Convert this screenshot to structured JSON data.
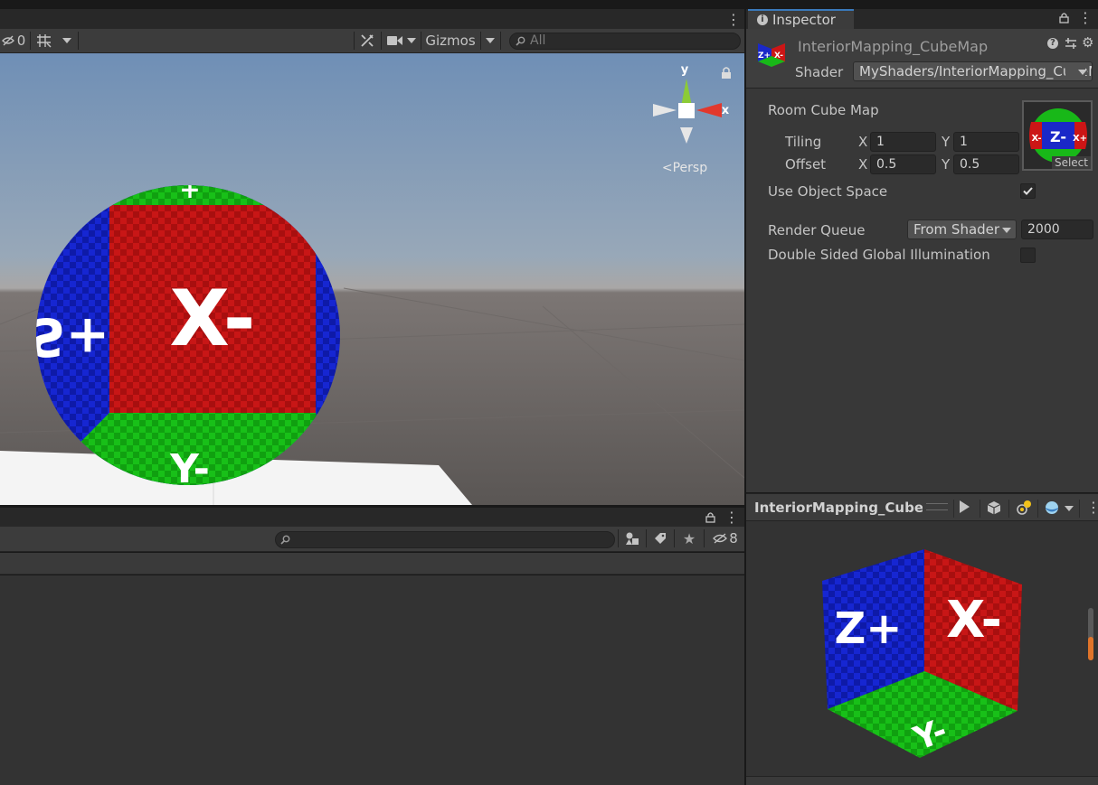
{
  "scene_toolbar": {
    "hidden_count": "0",
    "gizmos_label": "Gizmos",
    "search_placeholder": "All"
  },
  "viewport": {
    "axis_y": "y",
    "axis_x": "x",
    "projection_label": "<Persp",
    "sphere_labels": [
      "X-",
      "S+",
      "Y-",
      "+"
    ]
  },
  "project": {
    "hidden_count": "8"
  },
  "inspector": {
    "tab_label": "Inspector",
    "asset_name": "InteriorMapping_CubeMap",
    "shader_label": "Shader",
    "shader_value": "MyShaders/InteriorMapping_CubeMap",
    "room_cube_map_label": "Room Cube Map",
    "tiling_label": "Tiling",
    "offset_label": "Offset",
    "x_label": "X",
    "y_label": "Y",
    "tiling_x": "1",
    "tiling_y": "1",
    "offset_x": "0.5",
    "offset_y": "0.5",
    "select_label": "Select",
    "use_object_space_label": "Use Object Space",
    "use_object_space_checked": true,
    "render_queue_label": "Render Queue",
    "render_queue_mode": "From Shader",
    "render_queue_value": "2000",
    "double_sided_gi_label": "Double Sided Global Illumination",
    "double_sided_gi_checked": false
  },
  "preview": {
    "title": "InteriorMapping_CubeMa",
    "cube_labels": [
      "Z+",
      "X-",
      "Y-"
    ]
  },
  "colors": {
    "accent": "#3a79bb",
    "face_red": "#c31414",
    "face_blue": "#1424c8",
    "face_green": "#14b414",
    "sky_top": "#6f8fb6",
    "ground": "#5e5a58"
  },
  "icons": [
    "visibility-off-icon",
    "grid-icon",
    "tools-icon",
    "camera-icon",
    "search-icon",
    "lock-icon",
    "kebab-menu-icon",
    "info-icon",
    "help-icon",
    "preset-icon",
    "gear-icon",
    "play-icon",
    "cube-icon",
    "lights-icon",
    "sphere-icon",
    "filter-type-icon",
    "label-icon",
    "star-icon",
    "eye-off-icon",
    "checkmark-icon"
  ]
}
